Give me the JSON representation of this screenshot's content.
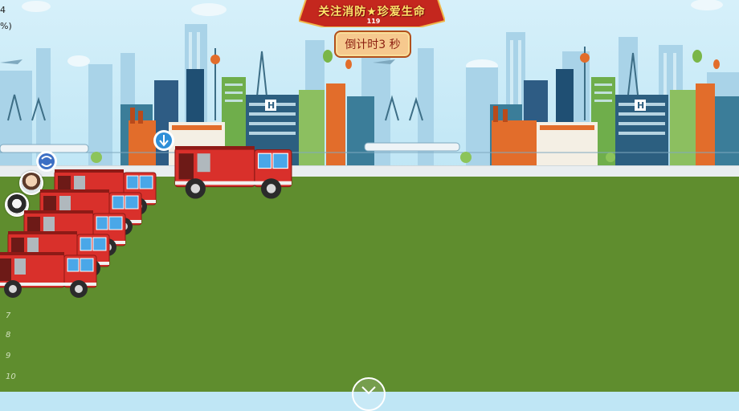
{
  "banner": {
    "title": "关注消防★珍爱生命",
    "subtitle": "119"
  },
  "countdown": {
    "label": "倒计时3 秒"
  },
  "left_edge": {
    "line1": "4",
    "line2": "%)"
  },
  "lane_numbers": [
    "7",
    "8",
    "9",
    "10"
  ],
  "icons": [
    "checkpoint-marker-icon",
    "chevron-down-icon",
    "fire-truck-icon",
    "avatar-icon"
  ],
  "colors": {
    "truck_red": "#d9302b",
    "grass": "#5f8d2e",
    "sky": "#bfe6f5",
    "banner_gold": "#ffe46a",
    "countdown_bg": "#f6c98e"
  }
}
